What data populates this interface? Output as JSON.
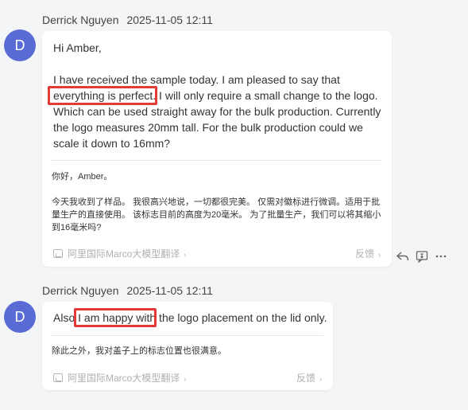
{
  "messages": [
    {
      "sender": "Derrick Nguyen",
      "time": "2025-11-05 12:11",
      "avatar": "D",
      "text_en": "Hi Amber,\n\nI have received the sample today. I am pleased to say that everything is perfect. I will only require a small change to the logo. Which can be used straight away for the bulk production. Currently the logo measures 20mm tall. For the bulk production could we scale it down to 16mm?",
      "highlight": "everything is perfect.",
      "text_zh": "你好，Amber。\n\n今天我收到了样品。 我很高兴地说，一切都很完美。 仅需对徽标进行微调。适用于批量生产的直接使用。 该标志目前的高度为20毫米。 为了批量生产，我们可以将其缩小到16毫米吗?",
      "translator": "阿里国际Marco大模型翻译",
      "feedback": "反馈"
    },
    {
      "sender": "Derrick Nguyen",
      "time": "2025-11-05 12:11",
      "avatar": "D",
      "text_en": "Also I am happy with the logo placement on the lid only.",
      "highlight": "I am happy with",
      "text_zh": "除此之外，我对盖子上的标志位置也很满意。",
      "translator": "阿里国际Marco大模型翻译",
      "feedback": "反馈"
    }
  ],
  "actions": {
    "icons": [
      "reply-icon",
      "translate-icon",
      "more-icon"
    ]
  },
  "colors": {
    "avatar_bg": "#5a6bd6",
    "highlight_border": "#e53935",
    "background": "#f4f5f7"
  }
}
